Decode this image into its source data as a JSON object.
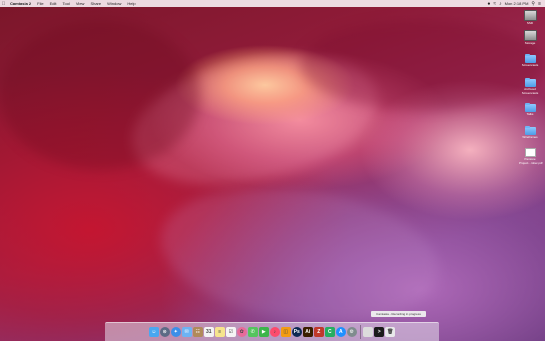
{
  "menubar": {
    "apple_icon": "apple-icon",
    "app_name": "Camtasia 2",
    "menus": [
      "File",
      "Edit",
      "Tool",
      "View",
      "Share",
      "Window",
      "Help"
    ],
    "clock": "Mon 2:18 PM",
    "status_icons": [
      "recording-icon",
      "wifi-icon",
      "volume-icon",
      "search-icon",
      "list-icon"
    ]
  },
  "desktop_icons": [
    {
      "label": "SSD",
      "type": "hdd"
    },
    {
      "label": "Storage",
      "type": "hdd"
    },
    {
      "label": "Screencasts",
      "type": "folder"
    },
    {
      "label": "Archived Screencasts",
      "type": "folder"
    },
    {
      "label": "Talks",
      "type": "folder"
    },
    {
      "label": "Wireframes",
      "type": "folder"
    },
    {
      "label": "Pantone Project...mber.pdf",
      "type": "document"
    }
  ],
  "tooltip": "Camtasia - Recording in progress",
  "dock": {
    "apps": [
      {
        "name": "finder-icon",
        "color": "#4aa7f0",
        "glyph": "☺"
      },
      {
        "name": "launchpad-icon",
        "color": "#5c6b85",
        "glyph": "⊙"
      },
      {
        "name": "safari-icon",
        "color": "#3b8fe8",
        "glyph": "✦"
      },
      {
        "name": "mail-icon",
        "color": "#6db3f2",
        "glyph": "✉"
      },
      {
        "name": "contacts-icon",
        "color": "#b08a5a",
        "glyph": "☷"
      },
      {
        "name": "calendar-icon",
        "color": "#f3f3f3",
        "glyph": "31"
      },
      {
        "name": "notes-icon",
        "color": "#f6e58d",
        "glyph": "≡"
      },
      {
        "name": "reminders-icon",
        "color": "#f5f5f5",
        "glyph": "☑"
      },
      {
        "name": "photos-icon",
        "color": "#e86a9a",
        "glyph": "✿"
      },
      {
        "name": "messages-icon",
        "color": "#54c45e",
        "glyph": "✆"
      },
      {
        "name": "facetime-icon",
        "color": "#3bb54a",
        "glyph": "▶"
      },
      {
        "name": "music-icon",
        "color": "#fc4b6c",
        "glyph": "♪"
      },
      {
        "name": "ibooks-icon",
        "color": "#f39c12",
        "glyph": "◫"
      },
      {
        "name": "photoshop-icon",
        "color": "#0d2a52",
        "glyph": "Ps"
      },
      {
        "name": "illustrator-icon",
        "color": "#3a1e00",
        "glyph": "Ai"
      },
      {
        "name": "filezilla-icon",
        "color": "#c0392b",
        "glyph": "Z"
      },
      {
        "name": "camtasia-icon",
        "color": "#27ae60",
        "glyph": "C"
      },
      {
        "name": "app-store-icon",
        "color": "#1e90ff",
        "glyph": "A"
      },
      {
        "name": "system-preferences-icon",
        "color": "#7f8c8d",
        "glyph": "⚙"
      }
    ],
    "others": [
      {
        "name": "finder-window-icon",
        "color": "#dcdcdc",
        "glyph": ""
      },
      {
        "name": "terminal-icon",
        "color": "#1b1b1b",
        "glyph": ">"
      },
      {
        "name": "trash-icon",
        "color": "#e8e8ea",
        "glyph": "🗑"
      }
    ]
  }
}
